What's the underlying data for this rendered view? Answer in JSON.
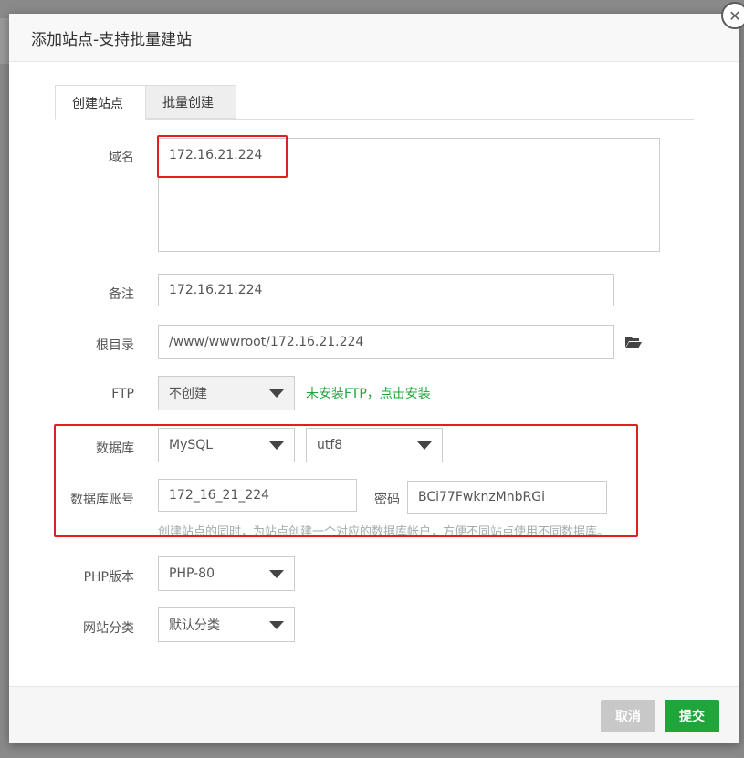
{
  "dialog": {
    "title": "添加站点-支持批量建站",
    "close_icon": "✕"
  },
  "tabs": [
    {
      "label": "创建站点",
      "active": true
    },
    {
      "label": "批量创建",
      "active": false
    }
  ],
  "form": {
    "domain": {
      "label": "域名",
      "value": "172.16.21.224"
    },
    "remark": {
      "label": "备注",
      "value": "172.16.21.224"
    },
    "root": {
      "label": "根目录",
      "value": "/www/wwwroot/172.16.21.224",
      "icon": "folder-open-icon"
    },
    "ftp": {
      "label": "FTP",
      "selected": "不创建",
      "hint": "未安装FTP，点击安装"
    },
    "database": {
      "label": "数据库",
      "type_selected": "MySQL",
      "charset_selected": "utf8"
    },
    "db_account": {
      "label": "数据库账号",
      "value": "172_16_21_224",
      "password_label": "密码",
      "password_value": "BCi77FwknzMnbRGi"
    },
    "db_hint": "创建站点的同时，为站点创建一个对应的数据库帐户，方便不同站点使用不同数据库。",
    "php": {
      "label": "PHP版本",
      "selected": "PHP-80"
    },
    "category": {
      "label": "网站分类",
      "selected": "默认分类"
    }
  },
  "footer": {
    "cancel_label": "取消",
    "submit_label": "提交"
  },
  "colors": {
    "accent_green": "#20a53a",
    "highlight_red": "#e02020"
  }
}
